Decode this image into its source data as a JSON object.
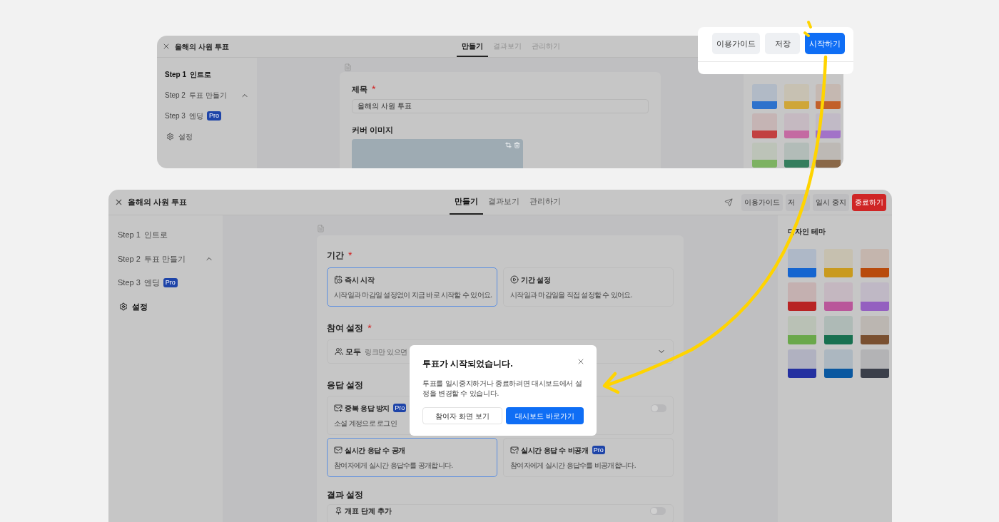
{
  "top_window": {
    "title": "올해의 사원 투표",
    "tabs": [
      {
        "label": "만들기",
        "selected": true
      },
      {
        "label": "결과보기",
        "selected": false
      },
      {
        "label": "관리하기",
        "selected": false
      }
    ],
    "sidebar": [
      {
        "kind": "step",
        "step": "Step 1",
        "label": "인트로",
        "selected": true
      },
      {
        "kind": "step",
        "step": "Step 2",
        "label": "투표 만들기",
        "selected": false,
        "expanded": true
      },
      {
        "kind": "step",
        "step": "Step 3",
        "label": "엔딩",
        "selected": false,
        "badge": "Pro"
      },
      {
        "kind": "settings",
        "label": "설정",
        "selected": false
      }
    ],
    "title_field": {
      "label": "제목",
      "required": "*",
      "value": "올해의 사원 투표"
    },
    "cover": {
      "label": "커버 이미지"
    },
    "swatches": [
      {
        "color": "#2e72cc"
      },
      {
        "color": "#cfa638"
      },
      {
        "color": "#c2602a"
      },
      {
        "color": "#c24040"
      },
      {
        "color": "#c46aa2"
      },
      {
        "color": "#a272c8"
      },
      {
        "color": "#7db262"
      },
      {
        "color": "#357e5e"
      },
      {
        "color": "#8a6848"
      }
    ]
  },
  "callout": {
    "buttons": [
      {
        "label": "이용가이드",
        "kind": "secondary"
      },
      {
        "label": "저장",
        "kind": "secondary"
      },
      {
        "label": "시작하기",
        "kind": "primary"
      }
    ]
  },
  "main_window": {
    "title": "올해의 사원 투표",
    "tabs": [
      {
        "label": "만들기",
        "selected": true
      },
      {
        "label": "결과보기",
        "selected": false
      },
      {
        "label": "관리하기",
        "selected": false
      }
    ],
    "buttons": [
      {
        "label": "이용가이드",
        "kind": "secondary"
      },
      {
        "label": "저",
        "kind": "secondary"
      },
      {
        "label": "일시 중지",
        "kind": "secondary"
      },
      {
        "label": "종료하기",
        "kind": "danger"
      }
    ],
    "sidebar": [
      {
        "kind": "step",
        "step": "Step 1",
        "label": "인트로",
        "selected": false
      },
      {
        "kind": "step",
        "step": "Step 2",
        "label": "투표 만들기",
        "selected": false,
        "expanded": true
      },
      {
        "kind": "step",
        "step": "Step 3",
        "label": "엔딩",
        "selected": false,
        "badge": "Pro"
      },
      {
        "kind": "settings",
        "label": "설정",
        "selected": true
      }
    ],
    "period": {
      "label": "기간",
      "required": "*",
      "options": [
        {
          "title": "즉시 시작",
          "desc": "시작일과 마감일 설정없이 지금 바로 시작할 수 있어요.",
          "selected": true
        },
        {
          "title": "기간 설정",
          "desc": "시작일과 마감일을 직접 설정할 수 있어요.",
          "selected": false
        }
      ]
    },
    "participation": {
      "label": "참여 설정",
      "required": "*",
      "value": "모두",
      "hint": "링크만 있으면"
    },
    "response": {
      "label": "응답 설정",
      "toggle_option": {
        "title": "중복 응답 방지",
        "badge": "Pro",
        "desc": "소셜 계정으로 로그인",
        "on": false
      },
      "options": [
        {
          "title": "실시간 응답 수 공개",
          "desc": "참여자에게 실시간 응답수를 공개합니다.",
          "selected": true
        },
        {
          "title": "실시간 응답 수 비공개",
          "badge": "Pro",
          "desc": "참여자에게 실시간 응답수를 비공개합니다.",
          "selected": false
        }
      ]
    },
    "result": {
      "label": "결과 설정",
      "toggle_option": {
        "title": "개표 단계 추가",
        "on": false
      }
    },
    "theme": {
      "title": "디자인 테마",
      "swatches": [
        {
          "color": "#1565d0"
        },
        {
          "color": "#c99a1e"
        },
        {
          "color": "#b84a0c"
        },
        {
          "color": "#b82323"
        },
        {
          "color": "#b9579a"
        },
        {
          "color": "#9460c0"
        },
        {
          "color": "#6aa84a"
        },
        {
          "color": "#187050"
        },
        {
          "color": "#7a5030"
        },
        {
          "color": "#2430a0"
        },
        {
          "color": "#0a58a0"
        },
        {
          "color": "#3b3f4a"
        }
      ]
    }
  },
  "dialog": {
    "title": "투표가 시작되었습니다.",
    "body": "투표를 일시중지하거나 종료하려면 대시보드에서 설정을 변경할 수 있습니다.",
    "buttons": [
      {
        "label": "참여자 화면 보기",
        "kind": "secondary"
      },
      {
        "label": "대시보드 바로가기",
        "kind": "primary"
      }
    ]
  }
}
